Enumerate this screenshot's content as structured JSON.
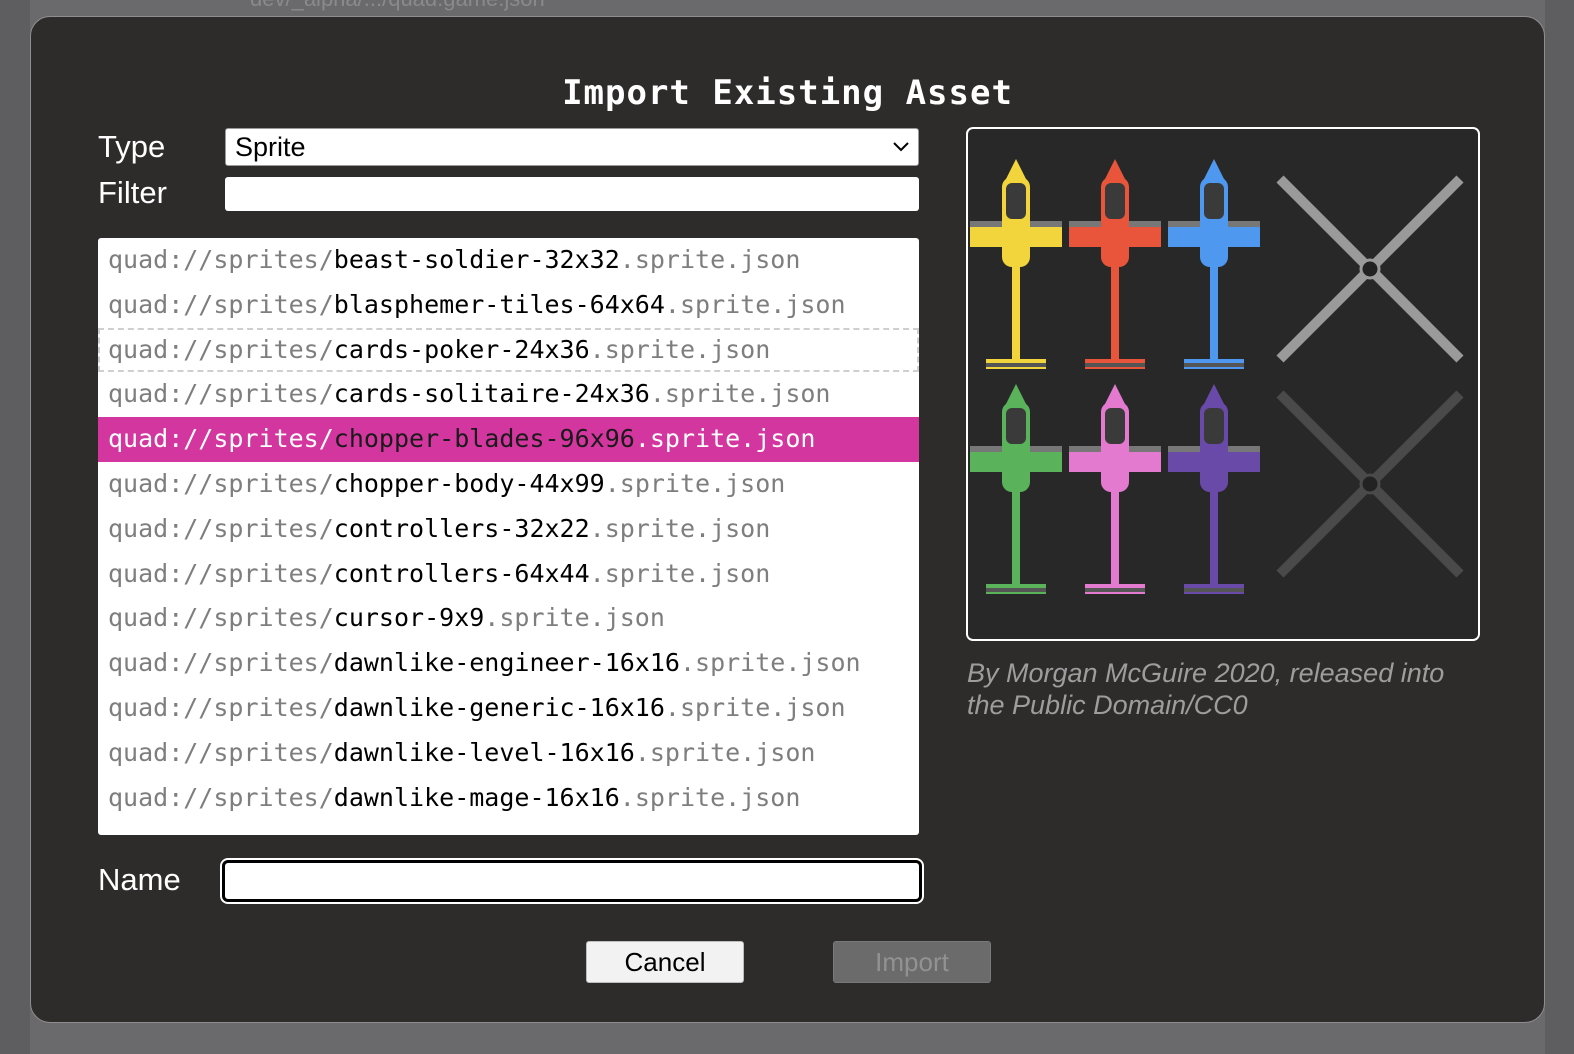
{
  "background": {
    "path_text": "dev/_alpha/.../quad.game.json"
  },
  "dialog": {
    "title": "Import Existing Asset",
    "type_label": "Type",
    "type_value": "Sprite",
    "filter_label": "Filter",
    "filter_value": "",
    "name_label": "Name",
    "name_value": "",
    "cancel_label": "Cancel",
    "import_label": "Import",
    "selected_index": 4,
    "focused_index": 2,
    "assets": [
      {
        "prefix": "quad://sprites/",
        "name": "beast-soldier-32x32",
        "ext": ".sprite.json"
      },
      {
        "prefix": "quad://sprites/",
        "name": "blasphemer-tiles-64x64",
        "ext": ".sprite.json"
      },
      {
        "prefix": "quad://sprites/",
        "name": "cards-poker-24x36",
        "ext": ".sprite.json"
      },
      {
        "prefix": "quad://sprites/",
        "name": "cards-solitaire-24x36",
        "ext": ".sprite.json"
      },
      {
        "prefix": "quad://sprites/",
        "name": "chopper-blades-96x96",
        "ext": ".sprite.json"
      },
      {
        "prefix": "quad://sprites/",
        "name": "chopper-body-44x99",
        "ext": ".sprite.json"
      },
      {
        "prefix": "quad://sprites/",
        "name": "controllers-32x22",
        "ext": ".sprite.json"
      },
      {
        "prefix": "quad://sprites/",
        "name": "controllers-64x44",
        "ext": ".sprite.json"
      },
      {
        "prefix": "quad://sprites/",
        "name": "cursor-9x9",
        "ext": ".sprite.json"
      },
      {
        "prefix": "quad://sprites/",
        "name": "dawnlike-engineer-16x16",
        "ext": ".sprite.json"
      },
      {
        "prefix": "quad://sprites/",
        "name": "dawnlike-generic-16x16",
        "ext": ".sprite.json"
      },
      {
        "prefix": "quad://sprites/",
        "name": "dawnlike-level-16x16",
        "ext": ".sprite.json"
      },
      {
        "prefix": "quad://sprites/",
        "name": "dawnlike-mage-16x16",
        "ext": ".sprite.json"
      }
    ],
    "preview": {
      "credit": "By Morgan McGuire 2020, released into the Public Domain/CC0",
      "chopper_colors": [
        "#f2d43c",
        "#e8553a",
        "#4f98f0",
        "#5ab35a",
        "#e47ad0",
        "#6a4aa8"
      ]
    }
  },
  "colors": {
    "accent": "#d3379f",
    "dialog_bg": "#2e2b2b"
  }
}
